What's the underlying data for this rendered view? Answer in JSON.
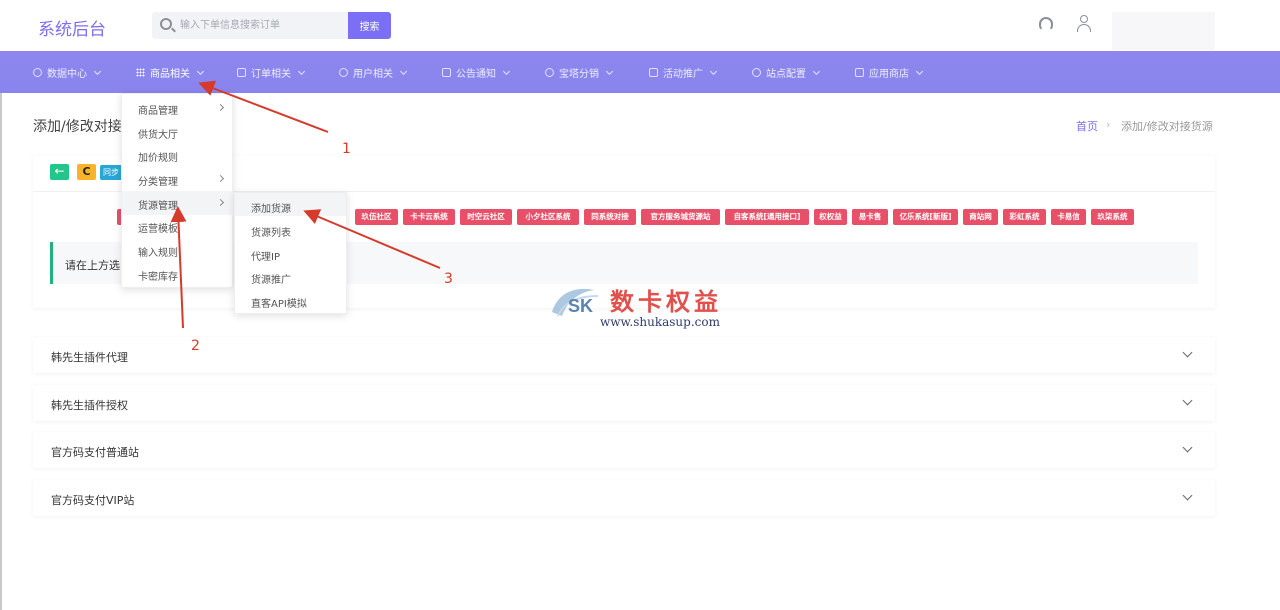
{
  "header": {
    "logo": "系统后台",
    "search_placeholder": "输入下单信息搜索订单",
    "search_button": "搜索"
  },
  "nav": {
    "items": [
      {
        "label": "数据中心",
        "icon": "dashboard-icon"
      },
      {
        "label": "商品相关",
        "icon": "grid-icon"
      },
      {
        "label": "订单相关",
        "icon": "order-icon"
      },
      {
        "label": "用户相关",
        "icon": "user-icon"
      },
      {
        "label": "公告通知",
        "icon": "notice-icon"
      },
      {
        "label": "宝塔分销",
        "icon": "link-icon"
      },
      {
        "label": "活动推广",
        "icon": "calendar-icon"
      },
      {
        "label": "站点配置",
        "icon": "gear-icon"
      },
      {
        "label": "应用商店",
        "icon": "cube-icon"
      }
    ]
  },
  "dropdown_products": {
    "items": [
      "商品管理",
      "供货大厅",
      "加价规则",
      "分类管理",
      "货源管理",
      "运营模板",
      "输入规则",
      "卡密库存"
    ]
  },
  "dropdown_sources": {
    "items": [
      "添加货源",
      "货源列表",
      "代理IP",
      "货源推广",
      "直客API模拟"
    ]
  },
  "page": {
    "title": "添加/修改对接货源",
    "breadcrumb_home": "首页",
    "breadcrumb_sep": "›",
    "breadcrumb_current": "添加/修改对接货源"
  },
  "card": {
    "back_icon": "←",
    "refresh_icon": "C",
    "sync_label": "同步"
  },
  "system_tags": [
    "玖伍社区",
    "卡卡云系统",
    "时空云社区",
    "小夕社区系统",
    "同系统对接",
    "官方服务城货源站",
    "自客系统[通用接口]",
    "权权益",
    "易卡售",
    "亿乐系统[新版]",
    "商站网",
    "彩虹系统",
    "卡易信",
    "玖柒系统"
  ],
  "notice": {
    "text": "请在上方选"
  },
  "accordions": [
    "韩先生插件代理",
    "韩先生插件授权",
    "官方码支付普通站",
    "官方码支付VIP站"
  ],
  "annotations": [
    "1",
    "2",
    "3"
  ],
  "watermark": {
    "logo_text": "SK",
    "cn": "数卡权益",
    "url": "www.shukasup.com"
  },
  "colors": {
    "nav_bg": "#8a84ee",
    "accent": "#7a6ff5",
    "tag_red": "#e8506a",
    "annotation_red": "#d63a2a"
  }
}
